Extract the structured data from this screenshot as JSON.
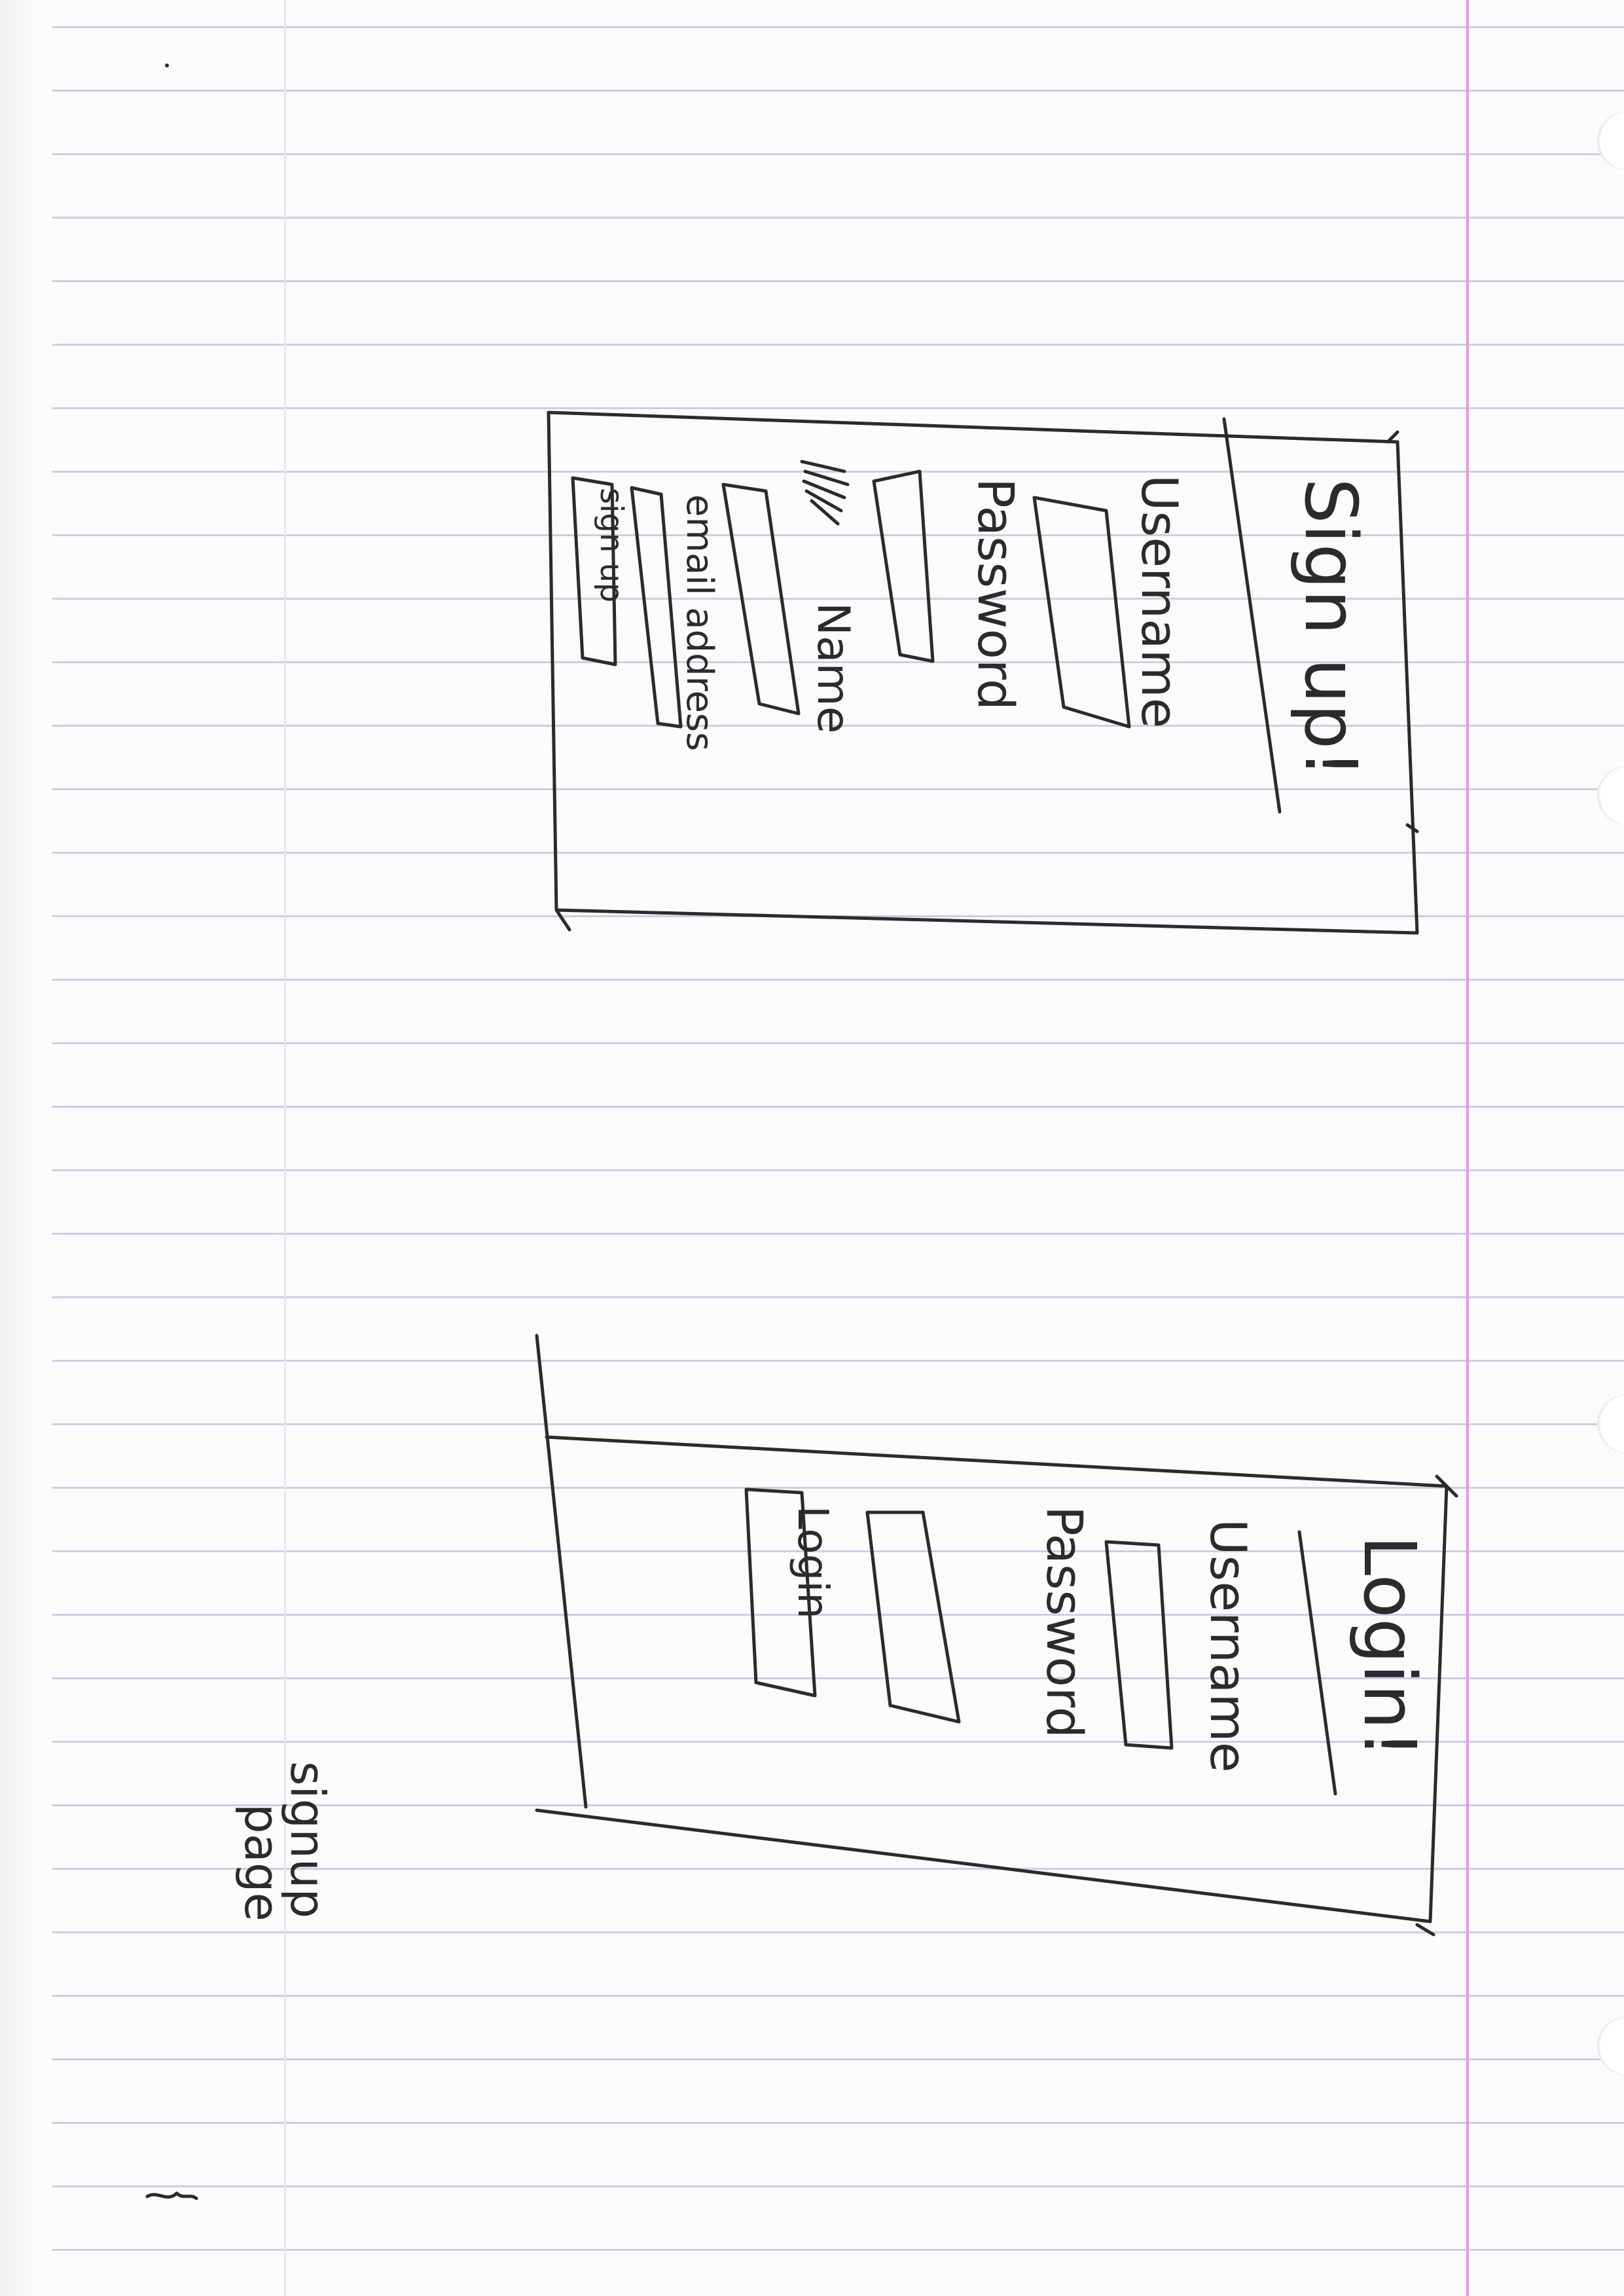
{
  "paper": {
    "rule_color": "#c8d0e4",
    "margin_color": "#e49ae4",
    "ink_color": "#2b2b2b"
  },
  "signup_wireframe": {
    "title": "Sign up!",
    "username_label": "Username",
    "password_label": "Password",
    "name_label": "Name",
    "email_label": "email address",
    "button_label": "sign up"
  },
  "login_wireframe": {
    "title": "Login!",
    "username_label": "Username",
    "password_label": "Password",
    "button_label": "Login"
  },
  "note": {
    "line1": "signup",
    "line2": "page"
  }
}
